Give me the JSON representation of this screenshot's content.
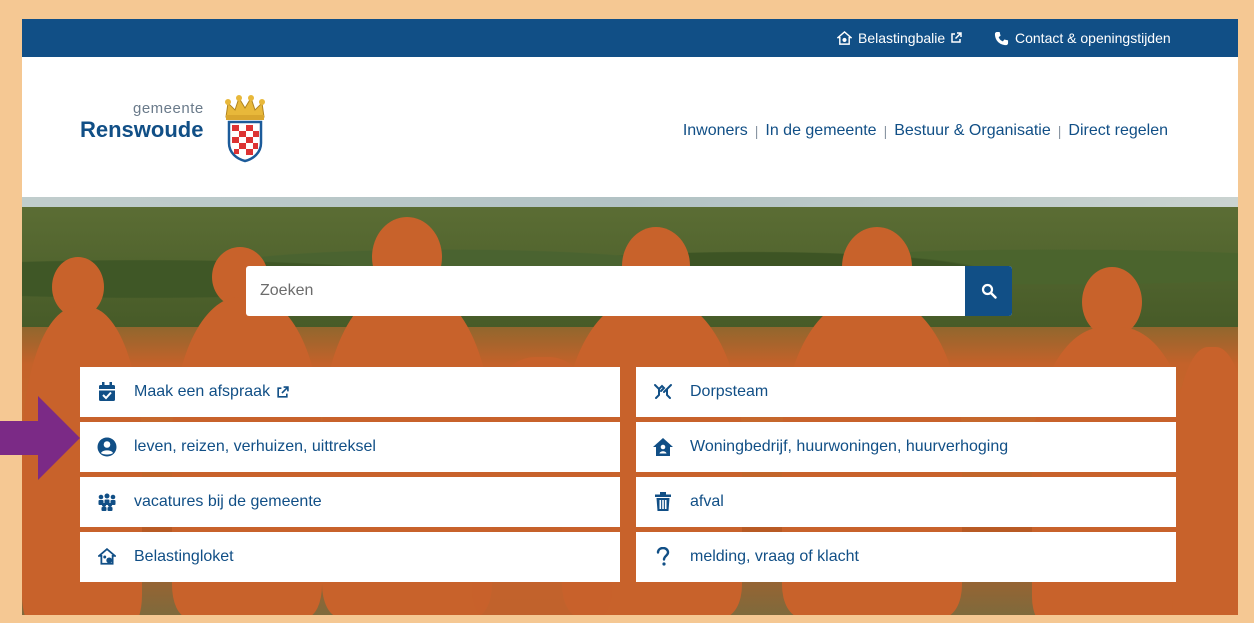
{
  "topbar": {
    "belastingbalie": "Belastingbalie",
    "contact": "Contact & openingstijden"
  },
  "logo": {
    "small": "gemeente",
    "big": "Renswoude"
  },
  "nav": [
    "Inwoners",
    "In de gemeente",
    "Bestuur & Organisatie",
    "Direct regelen"
  ],
  "search": {
    "placeholder": "Zoeken"
  },
  "quicklinks": {
    "left": [
      {
        "label": "Maak een afspraak",
        "icon": "calendar-check-icon"
      },
      {
        "label": "leven, reizen, verhuizen, uittreksel",
        "icon": "user-circle-icon"
      },
      {
        "label": "vacatures bij de gemeente",
        "icon": "people-group-icon"
      },
      {
        "label": "Belastingloket",
        "icon": "house-tax-icon"
      }
    ],
    "right": [
      {
        "label": "Dorpsteam",
        "icon": "hands-icon"
      },
      {
        "label": "Woningbedrijf, huurwoningen, huurverhoging",
        "icon": "house-person-icon"
      },
      {
        "label": "afval",
        "icon": "trash-icon"
      },
      {
        "label": "melding, vraag of klacht",
        "icon": "question-icon"
      }
    ]
  },
  "colors": {
    "brand": "#114f86",
    "frame": "#f5c893",
    "arrow": "#7b2a86"
  }
}
